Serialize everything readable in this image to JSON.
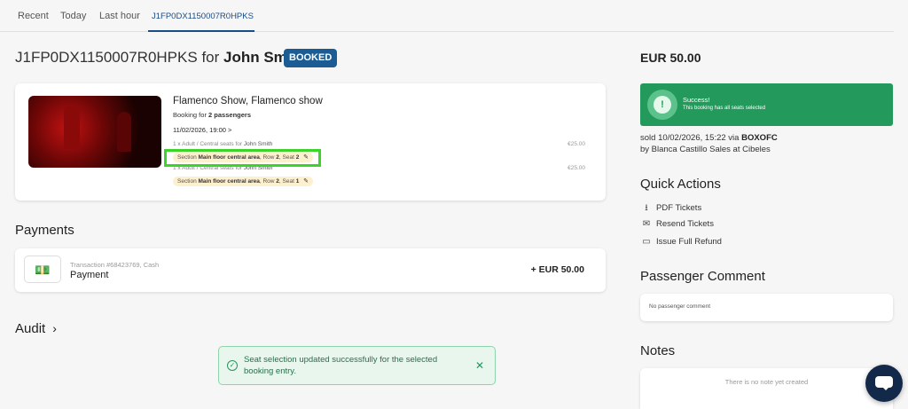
{
  "tabs": [
    {
      "label": "Recent"
    },
    {
      "label": "Today"
    },
    {
      "label": "Last hour"
    },
    {
      "label": "J1FP0DX1150007R0HPKS"
    }
  ],
  "booking": {
    "reference": "J1FP0DX1150007R0HPKS",
    "for_word": "for",
    "customer": "John Smith",
    "status": "BOOKED",
    "show_title": "Flamenco Show, Flamenco show",
    "booking_for_prefix": "Booking for",
    "passengers": "2 passengers",
    "datetime": "11/02/2026, 19:00 >",
    "tickets": [
      {
        "line": "1 x Adult / Central seats for",
        "name": "John Smith",
        "price": "€25.00",
        "section_prefix": "Section",
        "section": "Main floor central area",
        "row_prefix": ", Row",
        "row": "2",
        "seat_prefix": ", Seat",
        "seat": "2"
      },
      {
        "line": "1 x Adult / Central seats for",
        "name": "John Smith",
        "price": "€25.00",
        "section_prefix": "Section",
        "section": "Main floor central area",
        "row_prefix": ", Row",
        "row": "2",
        "seat_prefix": ", Seat",
        "seat": "1"
      }
    ]
  },
  "payments": {
    "heading": "Payments",
    "meta": "Transaction #68423769, Cash",
    "label": "Payment",
    "amount": "+ EUR 50.00"
  },
  "audit": {
    "heading": "Audit"
  },
  "toast": {
    "message": "Seat selection updated successfully for the selected booking entry."
  },
  "sidebar": {
    "total": "EUR 50.00",
    "success_title": "Success!",
    "success_sub": "This booking has all seats selected",
    "sold_prefix": "sold 10/02/2026, 15:22 via",
    "sold_channel": "BOXOFC",
    "sold_by": "by Blanca Castillo Sales at Cibeles",
    "quick_actions_heading": "Quick Actions",
    "quick_actions": [
      {
        "label": "PDF Tickets",
        "icon": "download-icon"
      },
      {
        "label": "Resend Tickets",
        "icon": "mail-icon"
      },
      {
        "label": "Issue Full Refund",
        "icon": "card-icon"
      }
    ],
    "passenger_comment_heading": "Passenger Comment",
    "passenger_comment": "No passenger comment",
    "notes_heading": "Notes",
    "notes_empty": "There is no note yet created"
  },
  "colors": {
    "accent": "#1a4c86",
    "success": "#239a5b",
    "highlight": "#3bd52a",
    "chat": "#13294a"
  }
}
